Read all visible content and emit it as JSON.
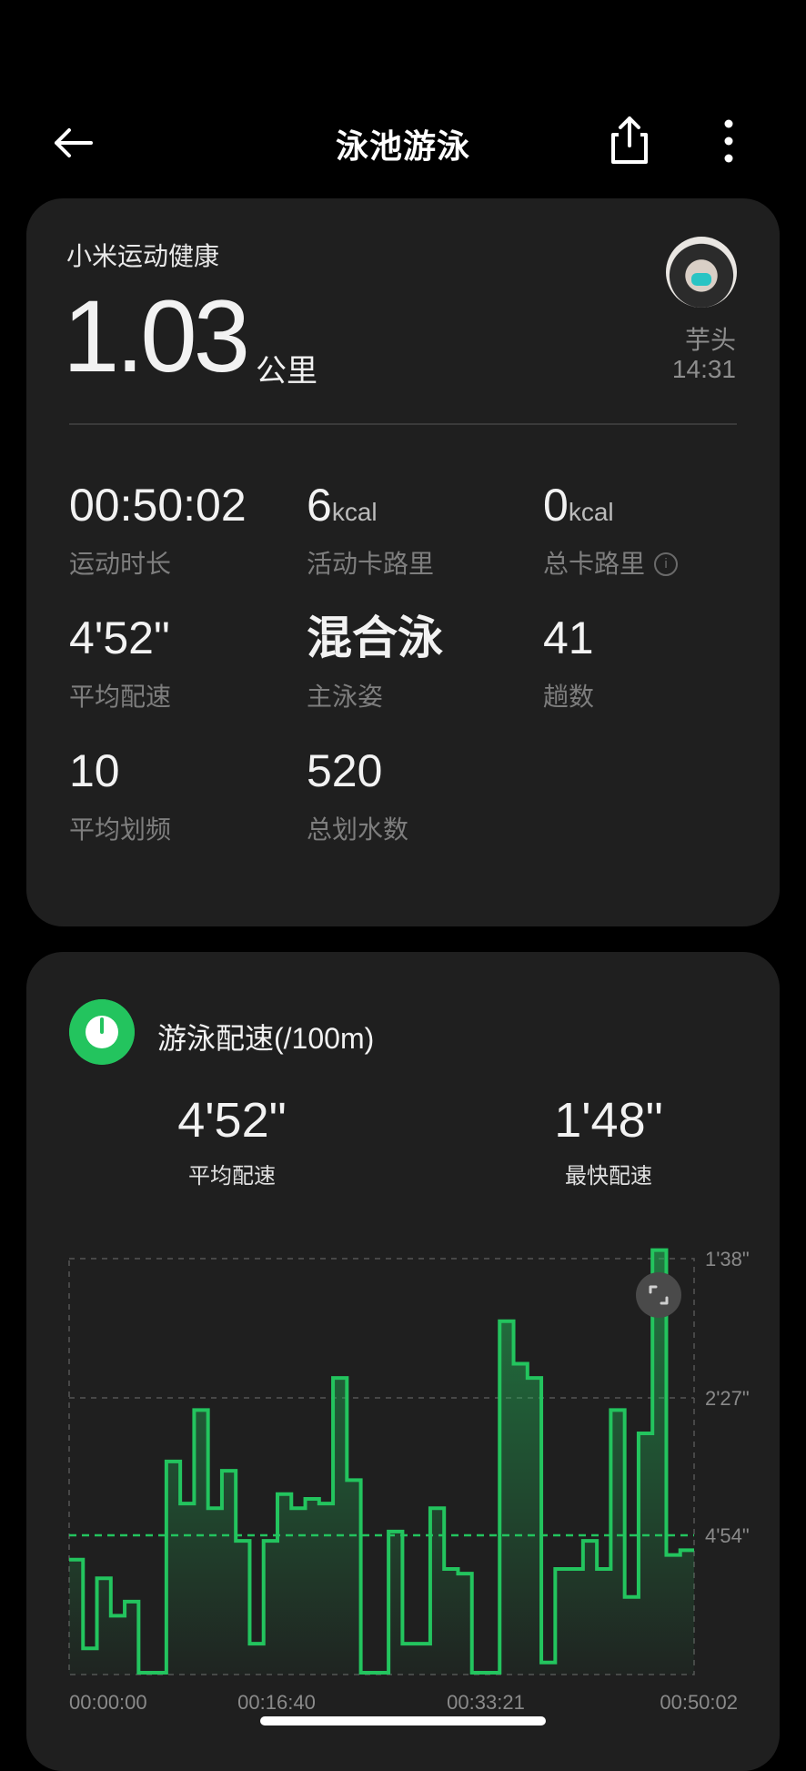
{
  "header": {
    "title": "泳池游泳",
    "icons": {
      "back": "back-arrow-icon",
      "share": "share-icon",
      "more": "more-vertical-icon"
    }
  },
  "summary": {
    "brand": "小米运动健康",
    "distance_value": "1.03",
    "distance_unit": "公里",
    "user_name": "芋头",
    "time": "14:31"
  },
  "stats": [
    {
      "value": "00:50:02",
      "unit": "",
      "label": "运动时长"
    },
    {
      "value": "6",
      "unit": "kcal",
      "label": "活动卡路里"
    },
    {
      "value": "0",
      "unit": "kcal",
      "label": "总卡路里"
    },
    {
      "value": "4'52\"",
      "unit": "",
      "label": "平均配速"
    },
    {
      "value": "混合泳",
      "unit": "",
      "label": "主泳姿"
    },
    {
      "value": "41",
      "unit": "",
      "label": "趟数"
    },
    {
      "value": "10",
      "unit": "",
      "label": "平均划频"
    },
    {
      "value": "520",
      "unit": "",
      "label": "总划水数"
    }
  ],
  "pace": {
    "title": "游泳配速(/100m)",
    "avg_value": "4'52\"",
    "avg_label": "平均配速",
    "best_value": "1'48\"",
    "best_label": "最快配速"
  },
  "chart_data": {
    "type": "area",
    "title": "游泳配速(/100m)",
    "y_ticks": [
      "1'38\"",
      "2'27\"",
      "4'54\""
    ],
    "x_ticks": [
      "00:00:00",
      "00:16:40",
      "00:33:21",
      "00:50:02"
    ],
    "average_line": "4'52\"",
    "color": "#23c45e",
    "series": [
      {
        "values_pace_seconds": [
          320,
          415,
          340,
          380,
          365,
          460,
          460,
          215,
          260,
          160,
          265,
          225,
          300,
          410,
          300,
          250,
          265,
          255,
          260,
          140,
          235,
          445,
          445,
          290,
          410,
          410,
          265,
          330,
          335,
          470,
          470,
          120,
          135,
          140,
          430,
          330,
          330,
          300,
          330,
          160,
          360,
          185,
          95,
          315,
          310
        ]
      }
    ],
    "accent": "#23c45e"
  }
}
